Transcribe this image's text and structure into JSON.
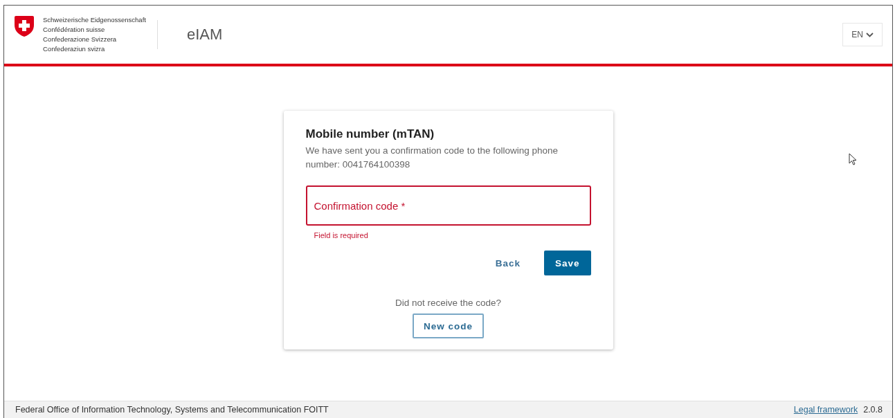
{
  "header": {
    "org_lines": [
      "Schweizerische Eidgenossenschaft",
      "Confédération suisse",
      "Confederazione Svizzera",
      "Confederaziun svizra"
    ],
    "app_name": "eIAM",
    "language": "EN"
  },
  "card": {
    "title": "Mobile number (mTAN)",
    "message": "We have sent you a confirmation code to the following phone number: 0041764100398",
    "field": {
      "placeholder": "Confirmation code *",
      "invalid": true,
      "error": "Field is required"
    },
    "buttons": [
      {
        "label": "Back",
        "kind": "link"
      },
      {
        "label": "Save",
        "kind": "primary"
      }
    ],
    "resend_prompt": "Did not receive the code?",
    "resend_button": "New code"
  },
  "footer": {
    "office": "Federal Office of Information Technology, Systems and Telecommunication FOITT",
    "link": "Legal framework",
    "version": "2.0.8"
  }
}
